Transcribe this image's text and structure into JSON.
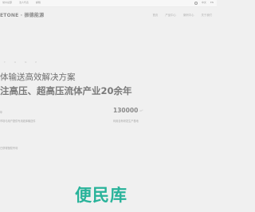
{
  "topbar": {
    "links": [
      "常州总部",
      "法人代表",
      "邮箱"
    ],
    "lang_icon": "globe-icon",
    "lang_labels": [
      "中文",
      "EN"
    ]
  },
  "header": {
    "brand": "ETONE · 振德能源",
    "nav": [
      "首页",
      "产品中心",
      "案例中心",
      "关于我们"
    ]
  },
  "hero": {
    "eyebrow": "T O N E",
    "subtitle": "体输送高效解决方案",
    "title": "注高压、超高压流体产业20余年"
  },
  "stats": {
    "left_prefix": "年",
    "left_desc": "市场与用户提供专用液体输送件",
    "left_bottom": "已获得授权专利",
    "right_value": "130000",
    "right_unit": "m²",
    "right_desc": "利用自有研发生产基地"
  },
  "watermark": "便民库"
}
